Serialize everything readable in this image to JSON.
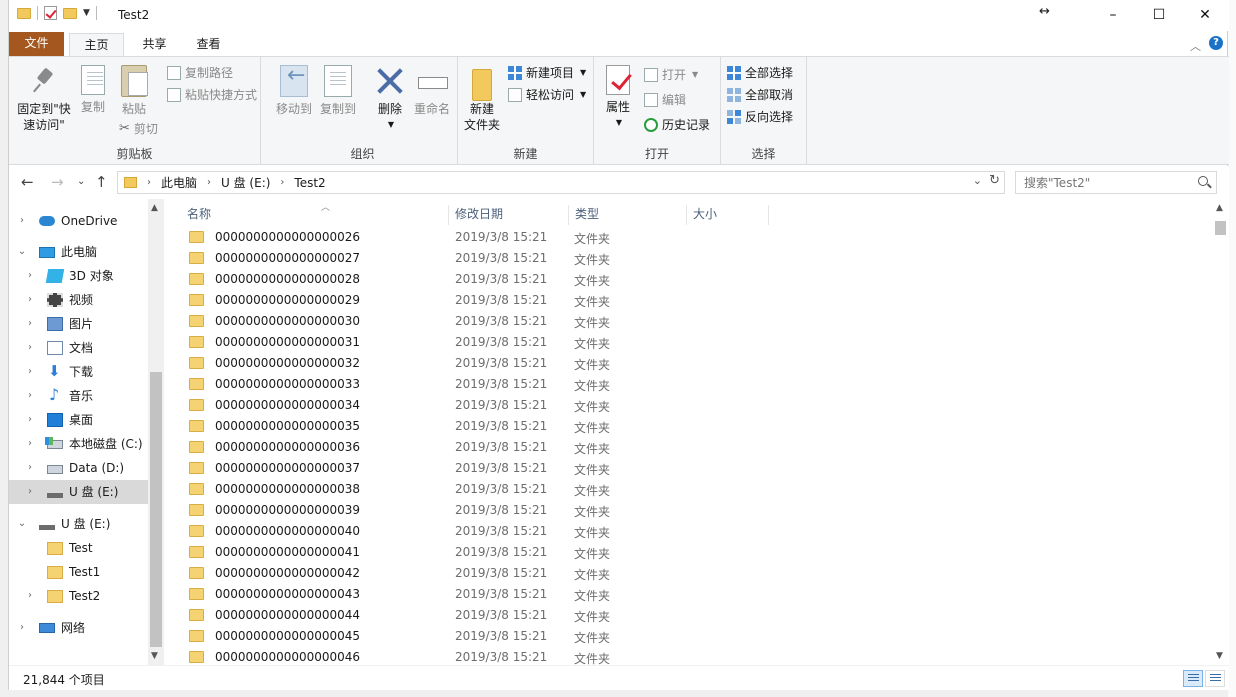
{
  "window": {
    "title": "Test2",
    "minimize": "–",
    "maximize": "☐",
    "close": "✕",
    "resize_indicator": "↔"
  },
  "ribbon_tabs": [
    "文件",
    "主页",
    "共享",
    "查看"
  ],
  "ribbon": {
    "clipboard": {
      "label": "剪贴板",
      "pin_line1": "固定到\"快",
      "pin_line2": "速访问\"",
      "copy": "复制",
      "paste": "粘贴",
      "copy_path": "复制路径",
      "paste_shortcut": "粘贴快捷方式",
      "cut": "剪切"
    },
    "organize": {
      "label": "组织",
      "move_to": "移动到",
      "copy_to": "复制到",
      "delete": "删除",
      "rename": "重命名"
    },
    "new": {
      "label": "新建",
      "new_folder_line1": "新建",
      "new_folder_line2": "文件夹",
      "new_item": "新建项目",
      "easy_access": "轻松访问"
    },
    "open": {
      "label": "打开",
      "properties": "属性",
      "open": "打开",
      "edit": "编辑",
      "history": "历史记录"
    },
    "select": {
      "label": "选择",
      "select_all": "全部选择",
      "select_none": "全部取消",
      "invert": "反向选择"
    }
  },
  "address": {
    "crumbs": [
      "此电脑",
      "U 盘 (E:)",
      "Test2"
    ],
    "search_placeholder": "搜索\"Test2\""
  },
  "nav": {
    "items": [
      {
        "label": "OneDrive",
        "icon": "onedrive-icon"
      },
      {
        "label": "此电脑",
        "icon": "this-pc-icon"
      },
      {
        "label": "3D 对象",
        "icon": "3d-objects-icon"
      },
      {
        "label": "视频",
        "icon": "video-icon"
      },
      {
        "label": "图片",
        "icon": "pictures-icon"
      },
      {
        "label": "文档",
        "icon": "documents-icon"
      },
      {
        "label": "下载",
        "icon": "downloads-icon"
      },
      {
        "label": "音乐",
        "icon": "music-icon"
      },
      {
        "label": "桌面",
        "icon": "desktop-icon"
      },
      {
        "label": "本地磁盘 (C:)",
        "icon": "drive-c-icon"
      },
      {
        "label": "Data (D:)",
        "icon": "drive-d-icon"
      },
      {
        "label": "U 盘 (E:)",
        "icon": "usb-drive-icon"
      },
      {
        "label": "U 盘 (E:)",
        "icon": "usb-drive-icon"
      },
      {
        "label": "Test",
        "icon": "folder-icon"
      },
      {
        "label": "Test1",
        "icon": "folder-icon"
      },
      {
        "label": "Test2",
        "icon": "folder-icon"
      },
      {
        "label": "网络",
        "icon": "network-icon"
      }
    ]
  },
  "columns": {
    "name": "名称",
    "date": "修改日期",
    "type": "类型",
    "size": "大小"
  },
  "files": [
    {
      "name": "0000000000000000026",
      "date": "2019/3/8 15:21",
      "type": "文件夹"
    },
    {
      "name": "0000000000000000027",
      "date": "2019/3/8 15:21",
      "type": "文件夹"
    },
    {
      "name": "0000000000000000028",
      "date": "2019/3/8 15:21",
      "type": "文件夹"
    },
    {
      "name": "0000000000000000029",
      "date": "2019/3/8 15:21",
      "type": "文件夹"
    },
    {
      "name": "0000000000000000030",
      "date": "2019/3/8 15:21",
      "type": "文件夹"
    },
    {
      "name": "0000000000000000031",
      "date": "2019/3/8 15:21",
      "type": "文件夹"
    },
    {
      "name": "0000000000000000032",
      "date": "2019/3/8 15:21",
      "type": "文件夹"
    },
    {
      "name": "0000000000000000033",
      "date": "2019/3/8 15:21",
      "type": "文件夹"
    },
    {
      "name": "0000000000000000034",
      "date": "2019/3/8 15:21",
      "type": "文件夹"
    },
    {
      "name": "0000000000000000035",
      "date": "2019/3/8 15:21",
      "type": "文件夹"
    },
    {
      "name": "0000000000000000036",
      "date": "2019/3/8 15:21",
      "type": "文件夹"
    },
    {
      "name": "0000000000000000037",
      "date": "2019/3/8 15:21",
      "type": "文件夹"
    },
    {
      "name": "0000000000000000038",
      "date": "2019/3/8 15:21",
      "type": "文件夹"
    },
    {
      "name": "0000000000000000039",
      "date": "2019/3/8 15:21",
      "type": "文件夹"
    },
    {
      "name": "0000000000000000040",
      "date": "2019/3/8 15:21",
      "type": "文件夹"
    },
    {
      "name": "0000000000000000041",
      "date": "2019/3/8 15:21",
      "type": "文件夹"
    },
    {
      "name": "0000000000000000042",
      "date": "2019/3/8 15:21",
      "type": "文件夹"
    },
    {
      "name": "0000000000000000043",
      "date": "2019/3/8 15:21",
      "type": "文件夹"
    },
    {
      "name": "0000000000000000044",
      "date": "2019/3/8 15:21",
      "type": "文件夹"
    },
    {
      "name": "0000000000000000045",
      "date": "2019/3/8 15:21",
      "type": "文件夹"
    },
    {
      "name": "0000000000000000046",
      "date": "2019/3/8 15:21",
      "type": "文件夹"
    }
  ],
  "status": {
    "count": "21,844 个项目"
  },
  "colors": {
    "file_tab": "#a4581f",
    "accent": "#1a73c9",
    "folder": "#f5d372"
  }
}
